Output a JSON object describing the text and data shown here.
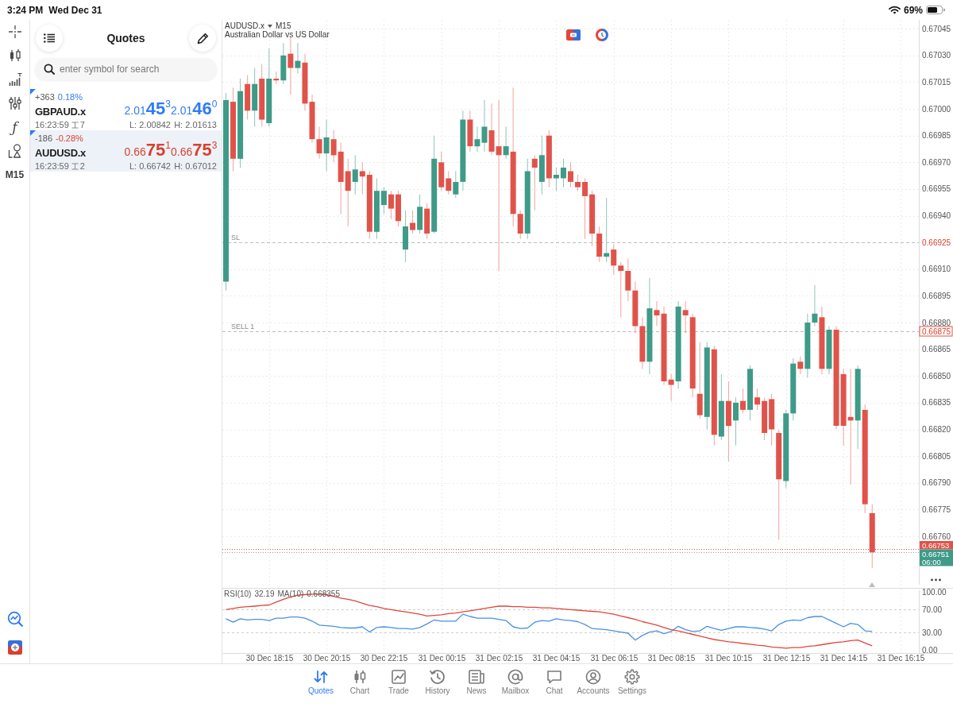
{
  "status_bar": {
    "time": "3:24 PM",
    "date": "Wed Dec 31",
    "battery": "69%"
  },
  "toolbar": {
    "function_glyph": "ƒ",
    "timeframe": "M15"
  },
  "quotes": {
    "title": "Quotes",
    "search": {
      "placeholder": "enter symbol for search"
    },
    "rows": [
      {
        "change_points": "+363",
        "change_percent": "0.18%",
        "rising": true,
        "symbol": "GBPAUD.x",
        "bid": "2.01**45**$^{3}$",
        "ask": "2.01**46**$^{0}$",
        "time": "16:23:59",
        "spread": "7",
        "low": "L: 2.00842",
        "high": "H: 2.01613",
        "selected": false
      },
      {
        "change_points": "-186",
        "change_percent": "-0.28%",
        "rising": false,
        "symbol": "AUDUSD.x",
        "bid": "0.66**75**$^{1}$",
        "ask": "0.66**75**$^{3}$",
        "time": "16:23:59",
        "spread": "2",
        "low": "L: 0.66742",
        "high": "H: 0.67012",
        "selected": true
      }
    ]
  },
  "chart": {
    "symbol": "AUDUSD.x",
    "timeframe": "M15",
    "description": "Australian Dollar vs US Dollar",
    "line_tags": [
      {
        "kind": "stop_loss",
        "price": "0.66925"
      },
      {
        "kind": "order",
        "price": "0.66875"
      },
      {
        "kind": "ask",
        "price": "0.66753"
      },
      {
        "kind": "bid",
        "price": "0.66751"
      }
    ],
    "bar_countdown": "06:00",
    "chart_data": {
      "type": "candlestick",
      "categories": [
        null,
        null,
        null,
        null,
        null,
        null,
        null,
        null,
        null,
        null,
        null,
        null,
        null,
        null,
        null,
        null,
        null,
        null,
        null,
        null,
        null,
        null,
        null,
        null,
        null,
        null,
        null,
        null,
        null,
        null,
        null,
        null,
        null,
        null,
        null,
        null,
        null,
        null,
        null,
        null,
        null,
        null,
        null,
        null,
        null,
        null,
        null,
        null,
        null,
        null,
        null,
        null,
        null,
        null,
        null,
        null,
        null,
        null,
        null,
        null,
        null,
        null,
        null,
        null,
        null,
        null,
        null,
        null,
        null,
        null,
        null,
        null,
        null,
        null,
        null,
        null,
        null,
        null,
        null,
        null,
        null,
        null,
        null,
        null,
        null,
        null,
        null,
        null,
        null,
        null,
        null,
        null,
        null,
        null,
        null,
        null,
        null
      ],
      "ohlc": [
        [
          0.66903,
          0.67009,
          0.66898,
          0.67005
        ],
        [
          0.67004,
          0.67012,
          0.66965,
          0.66972
        ],
        [
          0.66972,
          0.67017,
          0.66967,
          0.6701
        ],
        [
          0.67014,
          0.67019,
          0.66994,
          0.66999
        ],
        [
          0.66999,
          0.67023,
          0.6699,
          0.67014
        ],
        [
          0.67017,
          0.67025,
          0.6699,
          0.66994
        ],
        [
          0.66992,
          0.67034,
          0.6699,
          0.67017
        ],
        [
          0.67017,
          0.67021,
          0.67014,
          0.67016
        ],
        [
          0.67016,
          0.67037,
          0.67014,
          0.6703
        ],
        [
          0.67031,
          0.6704,
          0.67008,
          0.67023
        ],
        [
          0.67023,
          0.67037,
          0.6702,
          0.67027
        ],
        [
          0.67026,
          0.67031,
          0.66999,
          0.67003
        ],
        [
          0.67004,
          0.67008,
          0.66981,
          0.66983
        ],
        [
          0.66983,
          0.6699,
          0.66972,
          0.66975
        ],
        [
          0.66975,
          0.66994,
          0.66965,
          0.66984
        ],
        [
          0.66983,
          0.66988,
          0.6697,
          0.66974
        ],
        [
          0.66976,
          0.66981,
          0.66941,
          0.66959
        ],
        [
          0.66965,
          0.66972,
          0.66934,
          0.66954
        ],
        [
          0.66959,
          0.66974,
          0.66952,
          0.66966
        ],
        [
          0.66965,
          0.6697,
          0.66952,
          0.66962
        ],
        [
          0.66963,
          0.66965,
          0.66927,
          0.66931
        ],
        [
          0.66931,
          0.66961,
          0.66927,
          0.66954
        ],
        [
          0.66946,
          0.66956,
          0.66941,
          0.66954
        ],
        [
          0.66952,
          0.66954,
          0.66938,
          0.66944
        ],
        [
          0.66952,
          0.66954,
          0.66934,
          0.66937
        ],
        [
          0.66921,
          0.66943,
          0.66914,
          0.66934
        ],
        [
          0.66936,
          0.66943,
          0.6693,
          0.66932
        ],
        [
          0.66932,
          0.66952,
          0.6693,
          0.66945
        ],
        [
          0.66944,
          0.66947,
          0.66927,
          0.6693
        ],
        [
          0.66931,
          0.66985,
          0.6693,
          0.66972
        ],
        [
          0.6697,
          0.66976,
          0.66954,
          0.66956
        ],
        [
          0.66961,
          0.66965,
          0.66952,
          0.66954
        ],
        [
          0.66952,
          0.66965,
          0.6695,
          0.66959
        ],
        [
          0.66959,
          0.66999,
          0.66954,
          0.66994
        ],
        [
          0.66994,
          0.66999,
          0.66976,
          0.66979
        ],
        [
          0.66979,
          0.6699,
          0.66976,
          0.66983
        ],
        [
          0.66981,
          0.67005,
          0.66976,
          0.6699
        ],
        [
          0.66988,
          0.67003,
          0.66974,
          0.66976
        ],
        [
          0.66979,
          0.67005,
          0.66909,
          0.66974
        ],
        [
          0.66974,
          0.6699,
          0.66972,
          0.66979
        ],
        [
          0.66976,
          0.67012,
          0.66934,
          0.66941
        ],
        [
          0.66941,
          0.66943,
          0.66927,
          0.6693
        ],
        [
          0.6693,
          0.66972,
          0.66927,
          0.66965
        ],
        [
          0.66972,
          0.66974,
          0.66943,
          0.66967
        ],
        [
          0.66959,
          0.66985,
          0.66952,
          0.66974
        ],
        [
          0.66985,
          0.66988,
          0.66956,
          0.66961
        ],
        [
          0.66961,
          0.66967,
          0.66954,
          0.66963
        ],
        [
          0.66961,
          0.66972,
          0.66956,
          0.66967
        ],
        [
          0.66965,
          0.6697,
          0.66956,
          0.66959
        ],
        [
          0.66959,
          0.66963,
          0.66954,
          0.66956
        ],
        [
          0.66959,
          0.66961,
          0.66927,
          0.66951
        ],
        [
          0.66952,
          0.66954,
          0.66923,
          0.6693
        ],
        [
          0.6693,
          0.66934,
          0.66914,
          0.66917
        ],
        [
          0.66917,
          0.6695,
          0.66914,
          0.66919
        ],
        [
          0.66921,
          0.66924,
          0.66907,
          0.66912
        ],
        [
          0.66912,
          0.66914,
          0.66883,
          0.66909
        ],
        [
          0.66909,
          0.66916,
          0.66892,
          0.66898
        ],
        [
          0.66898,
          0.66903,
          0.66874,
          0.66878
        ],
        [
          0.66878,
          0.66883,
          0.66854,
          0.66858
        ],
        [
          0.66858,
          0.66905,
          0.66851,
          0.66888
        ],
        [
          0.66887,
          0.66892,
          0.66878,
          0.66884
        ],
        [
          0.66885,
          0.66889,
          0.66845,
          0.66847
        ],
        [
          0.66848,
          0.66851,
          0.66836,
          0.66845
        ],
        [
          0.66847,
          0.66892,
          0.66843,
          0.66889
        ],
        [
          0.66887,
          0.66892,
          0.66874,
          0.66884
        ],
        [
          0.66883,
          0.66885,
          0.66838,
          0.66843
        ],
        [
          0.6684,
          0.66869,
          0.66826,
          0.66828
        ],
        [
          0.66827,
          0.66869,
          0.6682,
          0.66866
        ],
        [
          0.66865,
          0.66867,
          0.66811,
          0.66817
        ],
        [
          0.66816,
          0.66851,
          0.66814,
          0.66836
        ],
        [
          0.66836,
          0.66847,
          0.66802,
          0.66822
        ],
        [
          0.66825,
          0.66838,
          0.66811,
          0.66835
        ],
        [
          0.66836,
          0.66843,
          0.66829,
          0.66831
        ],
        [
          0.66831,
          0.66856,
          0.66825,
          0.66854
        ],
        [
          0.66838,
          0.66843,
          0.66831,
          0.66834
        ],
        [
          0.66836,
          0.66838,
          0.66814,
          0.66818
        ],
        [
          0.66837,
          0.6684,
          0.66811,
          0.6682
        ],
        [
          0.66818,
          0.6682,
          0.66758,
          0.66792
        ],
        [
          0.66791,
          0.66831,
          0.66787,
          0.66829
        ],
        [
          0.66829,
          0.6686,
          0.66825,
          0.66857
        ],
        [
          0.66858,
          0.66861,
          0.66851,
          0.66854
        ],
        [
          0.66854,
          0.66885,
          0.66849,
          0.6688
        ],
        [
          0.6688,
          0.66901,
          0.66878,
          0.66885
        ],
        [
          0.66883,
          0.66889,
          0.66851,
          0.66854
        ],
        [
          0.66854,
          0.66878,
          0.66851,
          0.66876
        ],
        [
          0.66876,
          0.66878,
          0.6682,
          0.66822
        ],
        [
          0.66851,
          0.66854,
          0.66811,
          0.66822
        ],
        [
          0.66827,
          0.66854,
          0.66789,
          0.66825
        ],
        [
          0.66825,
          0.66856,
          0.66809,
          0.66854
        ],
        [
          0.66831,
          0.66834,
          0.66773,
          0.66778
        ],
        [
          0.66773,
          0.66778,
          0.66742,
          0.66751
        ],
        null,
        null,
        null,
        null,
        null,
        null
      ],
      "ref_lines": [
        {
          "axis": "y",
          "value": 0.66925,
          "label": "SL",
          "color": "#bcbcbc"
        },
        {
          "axis": "y",
          "value": 0.66875,
          "label": "SELL 1",
          "color": "#bcbcbc"
        },
        {
          "axis": "y",
          "value": 0.66753,
          "color": "#e0534a"
        },
        {
          "axis": "y",
          "value": 0.66751,
          "color": "#9a9a9a"
        }
      ],
      "ylim": [
        0.66731,
        0.6705
      ],
      "grid": true,
      "yticks": [
        {
          "value": 0.67045,
          "label": "0.67045"
        },
        {
          "value": 0.6703,
          "label": "0.67030"
        },
        {
          "value": 0.67015,
          "label": "0.67015"
        },
        {
          "value": 0.67,
          "label": "0.67000"
        },
        {
          "value": 0.66985,
          "label": "0.66985"
        },
        {
          "value": 0.6697,
          "label": "0.66970"
        },
        {
          "value": 0.66955,
          "label": "0.66955"
        },
        {
          "value": 0.6694,
          "label": "0.66940"
        },
        {
          "value": 0.6691,
          "label": "0.66910"
        },
        {
          "value": 0.66895,
          "label": "0.66895"
        },
        {
          "value": 0.6688,
          "label": "0.66880"
        },
        {
          "value": 0.66865,
          "label": "0.66865"
        },
        {
          "value": 0.6685,
          "label": "0.66850"
        },
        {
          "value": 0.66835,
          "label": "0.66835"
        },
        {
          "value": 0.6682,
          "label": "0.66820"
        },
        {
          "value": 0.66805,
          "label": "0.66805"
        },
        {
          "value": 0.6679,
          "label": "0.66790"
        },
        {
          "value": 0.66775,
          "label": "0.66775"
        },
        {
          "value": 0.6676,
          "label": "0.66760"
        }
      ]
    }
  },
  "indicator": {
    "legend_values": [
      "32.19",
      "0.668355"
    ],
    "chart_data": {
      "type": "line",
      "categories": [
        null,
        null,
        null,
        null,
        null,
        null,
        "30 Dec 18:15",
        null,
        null,
        null,
        null,
        null,
        null,
        null,
        "30 Dec 20:15",
        null,
        null,
        null,
        null,
        null,
        null,
        null,
        "30 Dec 22:15",
        null,
        null,
        null,
        null,
        null,
        null,
        null,
        "31 Dec 00:15",
        null,
        null,
        null,
        null,
        null,
        null,
        null,
        "31 Dec 02:15",
        null,
        null,
        null,
        null,
        null,
        null,
        null,
        "31 Dec 04:15",
        null,
        null,
        null,
        null,
        null,
        null,
        null,
        "31 Dec 06:15",
        null,
        null,
        null,
        null,
        null,
        null,
        null,
        "31 Dec 08:15",
        null,
        null,
        null,
        null,
        null,
        null,
        null,
        "31 Dec 10:15",
        null,
        null,
        null,
        null,
        null,
        null,
        null,
        "31 Dec 12:15",
        null,
        null,
        null,
        null,
        null,
        null,
        null,
        "31 Dec 14:15",
        null,
        null,
        null,
        null,
        null,
        null,
        null,
        "31 Dec 16:15",
        null,
        null
      ],
      "series": [
        {
          "name": "RSI(10)",
          "color": "#4a90e2",
          "values": [
            54,
            48,
            54,
            52,
            53,
            53,
            51,
            55,
            55,
            57,
            57,
            55,
            50,
            43,
            42,
            41,
            39,
            38,
            38,
            40,
            31,
            39,
            40,
            39,
            37,
            37,
            36,
            39,
            45,
            52,
            50,
            50,
            50,
            62,
            58,
            55,
            55,
            55,
            53,
            51,
            40,
            37,
            38,
            48,
            51,
            50,
            54,
            52,
            51,
            49,
            44,
            37,
            36,
            35,
            33,
            31,
            29,
            17,
            25,
            31,
            33,
            28,
            32,
            41,
            35,
            32,
            33,
            41,
            37,
            34,
            37,
            40,
            40,
            39,
            38,
            36,
            33,
            44,
            50,
            52,
            51,
            56,
            58,
            58,
            52,
            46,
            40,
            46,
            44,
            33,
            32,
            null,
            null,
            null,
            null,
            null,
            null
          ]
        },
        {
          "name": "MA(10)",
          "color": "#e0463c",
          "values": [
            70,
            72,
            74,
            75,
            76,
            77,
            78,
            83,
            88,
            92,
            95,
            96,
            97,
            97,
            96,
            93,
            90,
            88,
            85,
            81,
            77,
            75,
            72,
            70,
            68,
            66,
            64,
            62,
            59,
            60,
            61,
            63,
            64,
            66,
            68,
            70,
            72,
            74,
            76,
            76,
            75,
            75,
            74,
            74,
            73,
            73,
            72,
            71,
            70,
            69,
            68,
            67,
            66,
            64,
            62,
            59,
            56,
            53,
            49,
            46,
            43,
            39,
            35,
            33,
            30,
            27,
            24,
            21,
            18,
            16,
            14,
            13,
            11,
            10,
            8,
            7,
            5,
            4,
            3,
            4,
            4,
            6,
            7,
            9,
            11,
            13,
            14,
            16,
            17,
            12,
            7,
            null,
            null,
            null,
            null,
            null,
            null
          ]
        }
      ],
      "ylim": [
        -5.5,
        107.7
      ],
      "grid": true,
      "yticks": [
        {
          "value": 100,
          "label": "100.00"
        },
        {
          "value": 70,
          "label": "70.00"
        },
        {
          "value": 30,
          "label": "30.00"
        },
        {
          "value": 0,
          "label": "0.00"
        }
      ]
    }
  },
  "tabs": [
    {
      "label": "Quotes",
      "selected": true
    },
    {
      "label": "Chart",
      "selected": false
    },
    {
      "label": "Trade",
      "selected": false
    },
    {
      "label": "History",
      "selected": false
    },
    {
      "label": "News",
      "selected": false
    },
    {
      "label": "Mailbox",
      "selected": false
    },
    {
      "label": "Chat",
      "selected": false
    },
    {
      "label": "Accounts",
      "selected": false
    },
    {
      "label": "Settings",
      "selected": false
    }
  ]
}
